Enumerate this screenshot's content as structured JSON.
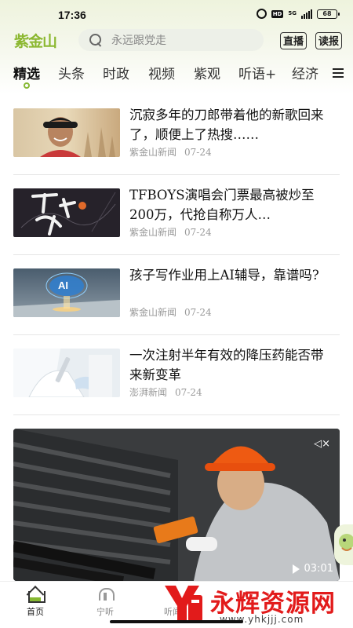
{
  "status_bar": {
    "time": "17:36",
    "network": "5G",
    "battery": "68"
  },
  "header": {
    "logo": "紫金山",
    "search_placeholder": "永远跟党走",
    "live_label": "直播",
    "read_label": "读报"
  },
  "tabs": [
    {
      "label": "精选",
      "active": true
    },
    {
      "label": "头条"
    },
    {
      "label": "时政"
    },
    {
      "label": "视频"
    },
    {
      "label": "紫观"
    },
    {
      "label": "听语+"
    },
    {
      "label": "经济"
    }
  ],
  "news": [
    {
      "title": "沉寂多年的刀郎带着他的新歌回来了，顺便上了热搜……",
      "source": "紫金山新闻",
      "date": "07-24"
    },
    {
      "title": "TFBOYS演唱会门票最高被炒至200万，代抢自称万人…",
      "source": "紫金山新闻",
      "date": "07-24"
    },
    {
      "title": "孩子写作业用上AI辅导，靠谱吗?",
      "source": "紫金山新闻",
      "date": "07-24"
    },
    {
      "title": "一次注射半年有效的降压药能否带来新变革",
      "source": "澎湃新闻",
      "date": "07-24"
    }
  ],
  "thumb_texts": {
    "ai_badge": "AI"
  },
  "video": {
    "duration": "03:01"
  },
  "bottom_nav": [
    {
      "label": "首页",
      "active": true
    },
    {
      "label": "宁听"
    },
    {
      "label": "听闻"
    }
  ],
  "watermark": {
    "text": "永辉资源网",
    "url": "www.yhkjjj.com"
  },
  "colors": {
    "brand_green": "#86b832",
    "watermark_red": "#e21b1b"
  }
}
